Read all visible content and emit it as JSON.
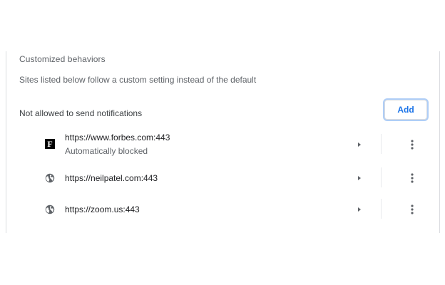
{
  "section": {
    "title": "Customized behaviors",
    "description": "Sites listed below follow a custom setting instead of the default"
  },
  "not_allowed": {
    "header": "Not allowed to send notifications",
    "add_label": "Add"
  },
  "sites": [
    {
      "url": "https://www.forbes.com:443",
      "subtitle": "Automatically blocked",
      "favicon": "forbes-logo",
      "favicon_letter": "F"
    },
    {
      "url": "https://neilpatel.com:443",
      "favicon": "globe-icon"
    },
    {
      "url": "https://zoom.us:443",
      "favicon": "globe-icon"
    }
  ],
  "colors": {
    "accent": "#1a73e8",
    "text": "#202124",
    "secondary_text": "#5f6368",
    "icon": "#5f6368",
    "divider": "#dadce0"
  }
}
